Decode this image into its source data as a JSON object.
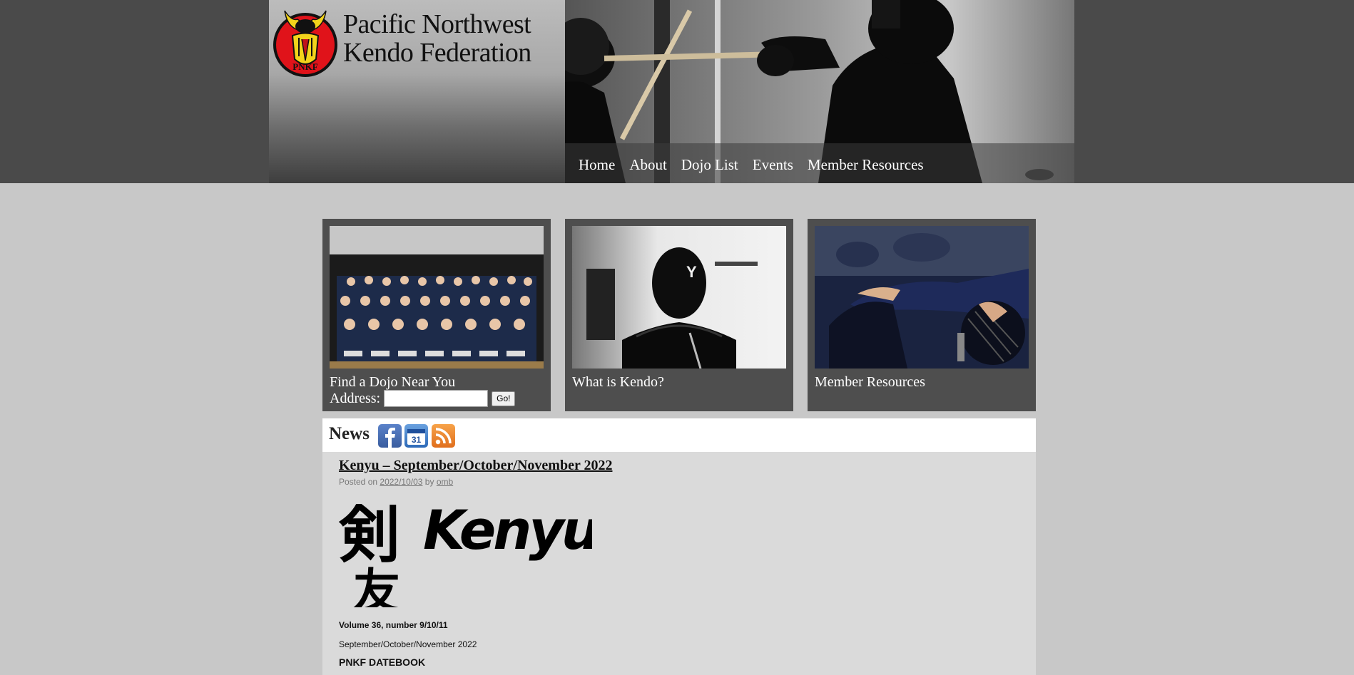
{
  "header": {
    "site_title_line1": "Pacific Northwest",
    "site_title_line2": "Kendo Federation",
    "logo_text": "PNKF"
  },
  "nav": {
    "items": [
      {
        "label": "Home"
      },
      {
        "label": "About"
      },
      {
        "label": "Dojo List"
      },
      {
        "label": "Events"
      },
      {
        "label": "Member Resources"
      }
    ]
  },
  "features": {
    "dojo": {
      "caption": "Find a Dojo Near You",
      "address_label": "Address:",
      "address_value": "",
      "go_label": "Go!"
    },
    "kendo": {
      "caption": "What is Kendo?"
    },
    "member": {
      "caption": "Member Resources"
    }
  },
  "news": {
    "title": "News",
    "icons": [
      "facebook-icon",
      "calendar-icon",
      "rss-icon"
    ],
    "calendar_day": "31",
    "post": {
      "title": "Kenyu – September/October/November 2022",
      "posted_on_label": "Posted on",
      "date": "2022/10/03",
      "by_label": "by",
      "author": "omb",
      "art_word": "Kenyu",
      "art_kanji_1": "剣",
      "art_kanji_2": "友",
      "volume": "Volume 36, number 9/10/11",
      "issue": "September/October/November 2022",
      "section": "PNKF DATEBOOK"
    }
  },
  "colors": {
    "header_bg": "#4a4a4a",
    "page_bg": "#c8c8c8",
    "feature_bg": "#4e4e4e",
    "news_bg": "#dadada",
    "logo_red": "#e0131a",
    "logo_yellow": "#f2d31b"
  }
}
